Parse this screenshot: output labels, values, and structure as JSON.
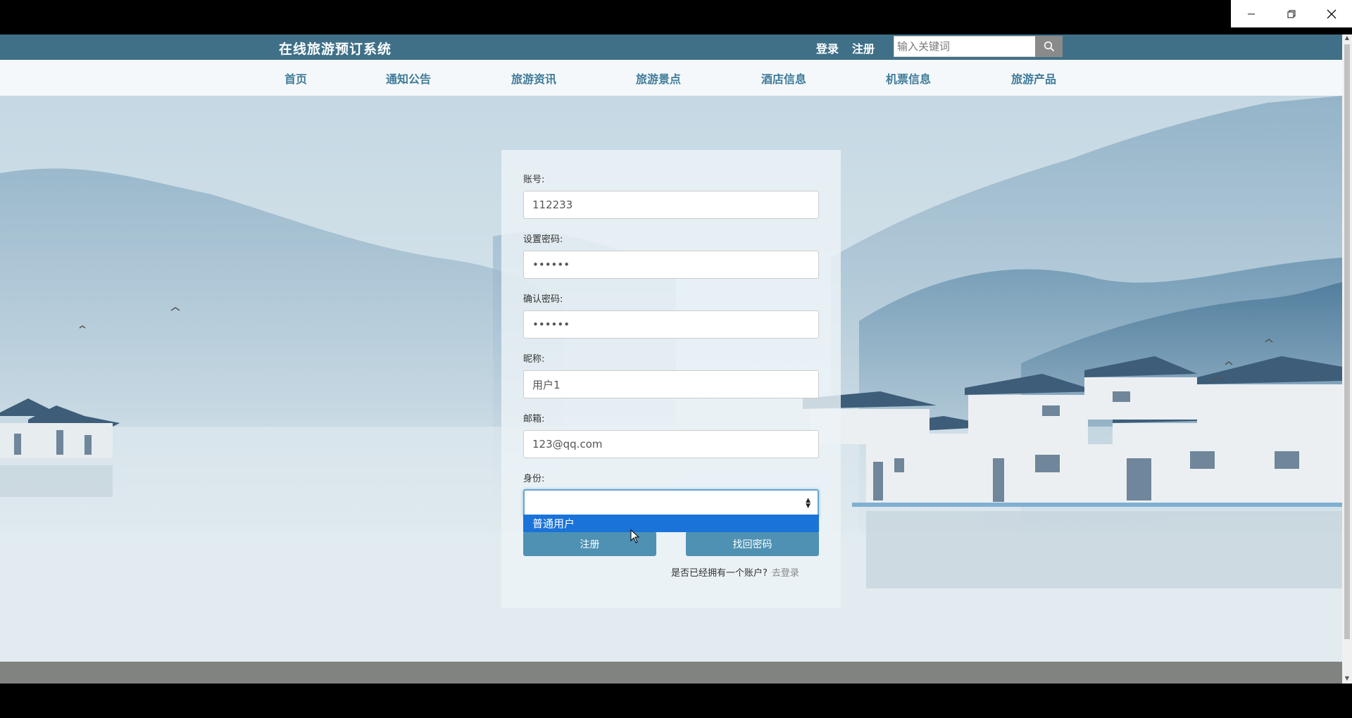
{
  "window": {
    "minimize_icon": "minimize-icon",
    "restore_icon": "restore-icon",
    "close_icon": "close-icon"
  },
  "header": {
    "site_title": "在线旅游预订系统",
    "login_link": "登录",
    "register_link": "注册",
    "search_placeholder": "输入关键词",
    "search_icon": "search-icon"
  },
  "nav": {
    "items": [
      {
        "label": "首页"
      },
      {
        "label": "通知公告"
      },
      {
        "label": "旅游资讯"
      },
      {
        "label": "旅游景点"
      },
      {
        "label": "酒店信息"
      },
      {
        "label": "机票信息"
      },
      {
        "label": "旅游产品"
      }
    ]
  },
  "form": {
    "account_label": "账号:",
    "account_value": "112233",
    "password_label": "设置密码:",
    "password_value": "••••••",
    "confirm_label": "确认密码:",
    "confirm_value": "••••••",
    "nickname_label": "昵称:",
    "nickname_value": "用户1",
    "email_label": "邮箱:",
    "email_value": "123@qq.com",
    "identity_label": "身份:",
    "identity_value": "",
    "identity_options": [
      "普通用户"
    ],
    "register_button": "注册",
    "recover_button": "找回密码",
    "has_account_text": "是否已经拥有一个账户?",
    "go_login_link": "去登录"
  },
  "colors": {
    "topbar": "#3f7088",
    "nav_text": "#3e7b99",
    "button": "#4f91b3",
    "dropdown_highlight": "#1a73d9"
  }
}
